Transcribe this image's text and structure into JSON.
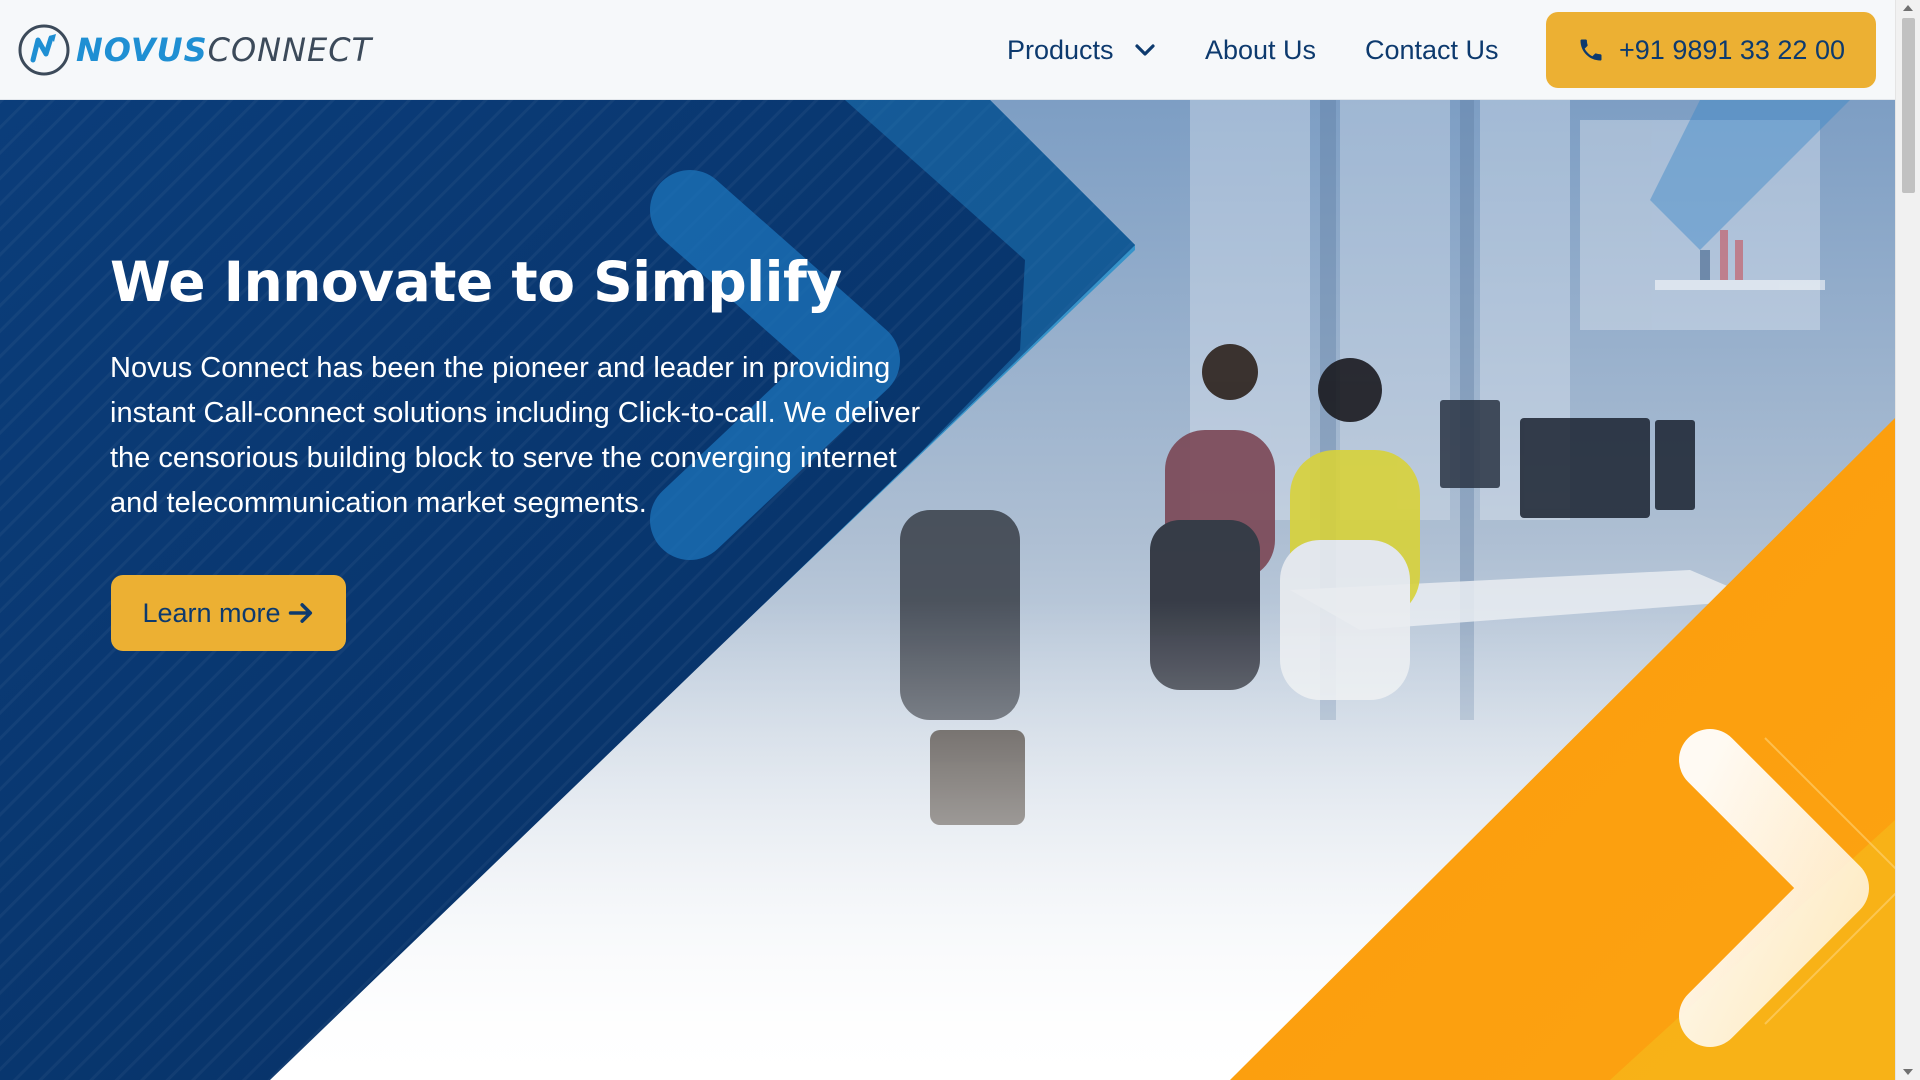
{
  "header": {
    "logo": {
      "part1": "NOVUS",
      "part2": "CONNECT"
    },
    "nav": {
      "products": "Products",
      "about": "About Us",
      "contact": "Contact Us"
    },
    "phone": "+91 9891 33 22 00"
  },
  "hero": {
    "title": "We Innovate to Simplify",
    "description": "Novus Connect has been the pioneer and leader in providing instant Call-connect solutions including Click-to-call. We deliver the censorious building block to serve the converging internet and telecommunication market segments.",
    "cta": "Learn more"
  },
  "icons": {
    "logo": "novus-logo-icon",
    "products_dropdown": "chevron-down-icon",
    "phone": "phone-icon",
    "cta_arrow": "arrow-right-icon"
  },
  "colors": {
    "brand_navy": "#0d3a6e",
    "brand_blue": "#1f8fd3",
    "accent_yellow": "#ecb033",
    "accent_orange": "#fb9b0c",
    "header_bg": "#f6f8fa"
  }
}
